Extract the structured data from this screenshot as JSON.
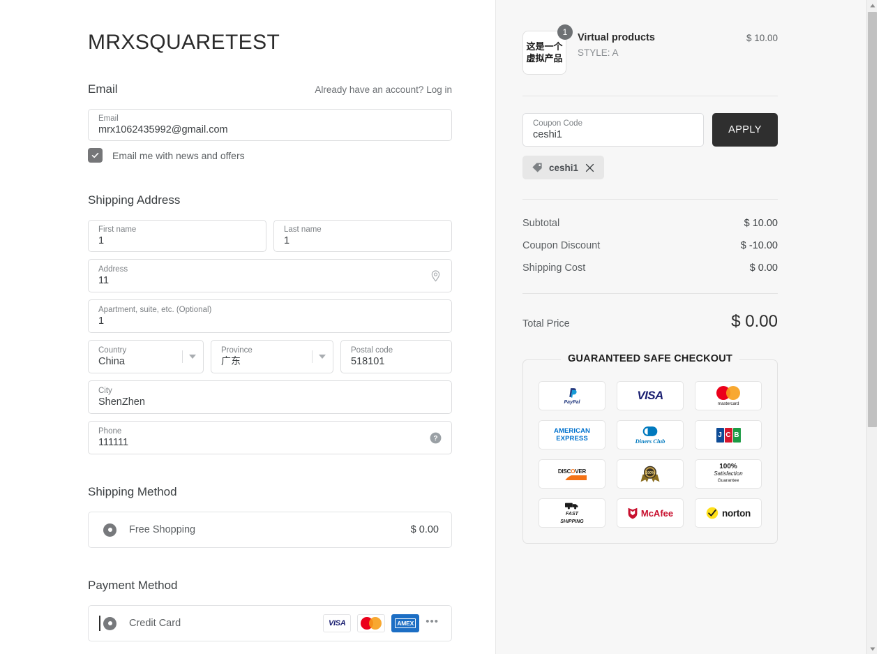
{
  "shop": {
    "title": "MRXSQUARETEST"
  },
  "email_section": {
    "heading": "Email",
    "account_note": "Already have an account?",
    "login_link": "Log in",
    "field_label": "Email",
    "field_value": "mrx1062435992@gmail.com",
    "newsletter_label": "Email me with news and offers",
    "newsletter_checked": true
  },
  "shipping_address": {
    "heading": "Shipping Address",
    "fields": [
      {
        "label": "First name",
        "value": "1"
      },
      {
        "label": "Last name",
        "value": "1"
      },
      {
        "label": "Address",
        "value": "11"
      },
      {
        "label": "Apartment, suite, etc. (Optional)",
        "value": "1"
      },
      {
        "label": "Country",
        "value": "China"
      },
      {
        "label": "Province",
        "value": "广东"
      },
      {
        "label": "Postal code",
        "value": "518101"
      },
      {
        "label": "City",
        "value": "ShenZhen"
      },
      {
        "label": "Phone",
        "value": "111111"
      }
    ]
  },
  "shipping_method": {
    "heading": "Shipping Method",
    "options": [
      {
        "label": "Free Shopping",
        "price": "$ 0.00",
        "selected": true
      }
    ]
  },
  "payment_method": {
    "heading": "Payment Method",
    "options": [
      {
        "label": "Credit Card",
        "selected": true
      }
    ],
    "card_logos": [
      "VISA",
      "mastercard",
      "AMEX"
    ],
    "more_indicator": "•••"
  },
  "summary": {
    "product": {
      "thumb_text": "这是一个虚拟产品",
      "quantity": "1",
      "name": "Virtual products",
      "variant": "STYLE: A",
      "price": "$ 10.00"
    },
    "coupon": {
      "label": "Coupon Code",
      "value": "ceshi1",
      "apply_label": "APPLY",
      "applied_chip": "ceshi1"
    },
    "totals": [
      {
        "label": "Subtotal",
        "value": "$ 10.00"
      },
      {
        "label": "Coupon Discount",
        "value": "$ -10.00"
      },
      {
        "label": "Shipping Cost",
        "value": "$ 0.00"
      }
    ],
    "total": {
      "label": "Total Price",
      "value": "$ 0.00"
    }
  },
  "trust": {
    "title": "GUARANTEED SAFE CHECKOUT",
    "badges": [
      {
        "name": "paypal",
        "text": "PayPal"
      },
      {
        "name": "visa",
        "text": "VISA"
      },
      {
        "name": "mastercard",
        "text": "mastercard"
      },
      {
        "name": "american-express",
        "line1": "AMERICAN",
        "line2": "EXPRESS"
      },
      {
        "name": "diners-club",
        "text": "Diners Club"
      },
      {
        "name": "jcb",
        "l1": "J",
        "l2": "C",
        "l3": "B"
      },
      {
        "name": "discover",
        "text": "DISC",
        "accent": "O",
        "tail": "VER"
      },
      {
        "name": "guarantee-seal",
        "text": "100%"
      },
      {
        "name": "satisfaction",
        "line1": "100%",
        "line2": "Satisfaction",
        "line3": "Guarantee"
      },
      {
        "name": "fast-shipping",
        "line1": "FAST",
        "line2": "SHIPPING"
      },
      {
        "name": "mcafee",
        "text": "McAfee"
      },
      {
        "name": "norton",
        "text": "norton"
      }
    ]
  },
  "colors": {
    "apply_button": "#2f2f2f",
    "panel_bg": "#f7f7f7",
    "radio": "#77797c",
    "checkbox": "#757678"
  }
}
